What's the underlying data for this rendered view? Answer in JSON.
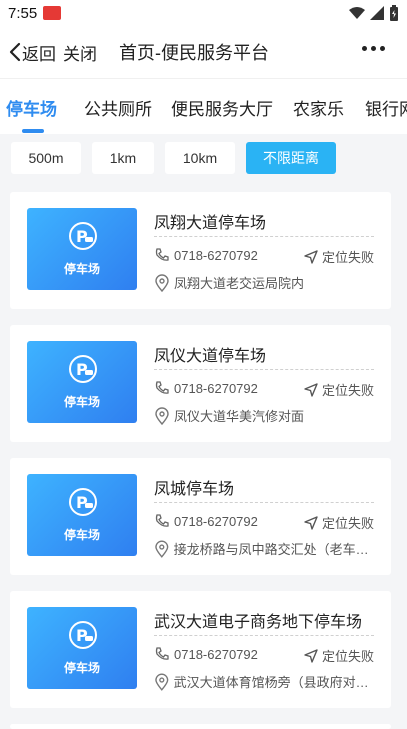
{
  "status_bar": {
    "time": "7:55"
  },
  "nav": {
    "back_label": "返回",
    "close_label": "关闭",
    "title": "首页-便民服务平台"
  },
  "tabs": [
    {
      "label": "停车场",
      "active": true
    },
    {
      "label": "公共厕所"
    },
    {
      "label": "便民服务大厅"
    },
    {
      "label": "农家乐"
    },
    {
      "label": "银行网点"
    }
  ],
  "filters": [
    {
      "label": "500m"
    },
    {
      "label": "1km"
    },
    {
      "label": "10km"
    },
    {
      "label": "不限距离",
      "active": true
    }
  ],
  "accent_color": "#2f8cf0",
  "filter_active_color": "#2ab3f4",
  "thumb_label": "停车场",
  "location_status": "定位失败",
  "places": [
    {
      "name": "凤翔大道停车场",
      "phone": "0718-6270792",
      "address": "凤翔大道老交运局院内"
    },
    {
      "name": "凤仪大道停车场",
      "phone": "0718-6270792",
      "address": "凤仪大道华美汽修对面"
    },
    {
      "name": "凤城停车场",
      "phone": "0718-6270792",
      "address": "接龙桥路与凤中路交汇处（老车站）"
    },
    {
      "name": "武汉大道电子商务地下停车场",
      "phone": "0718-6270792",
      "address": "武汉大道体育馆杨旁（县政府对面）"
    }
  ]
}
